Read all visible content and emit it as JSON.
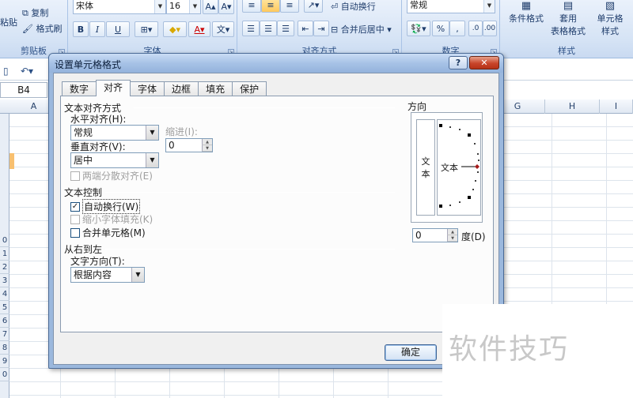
{
  "ribbon": {
    "clipboard": {
      "paste": "粘贴",
      "copy": "复制",
      "format_painter": "格式刷",
      "label": "剪贴板"
    },
    "font": {
      "name": "宋体",
      "size": "16",
      "bold": "B",
      "italic": "I",
      "underline": "U",
      "label": "字体"
    },
    "alignment": {
      "wrap_text": "自动换行",
      "merge_center": "合并后居中",
      "label": "对齐方式"
    },
    "number": {
      "format": "常规",
      "percent": "%",
      "comma": ",",
      "label": "数字"
    },
    "styles": {
      "conditional": "条件格式",
      "table_format_1": "套用",
      "table_format_2": "表格格式",
      "cell_style_1": "单元格",
      "cell_style_2": "样式",
      "label": "样式"
    }
  },
  "sheet": {
    "name_box": "B4",
    "columns": [
      "A",
      "G",
      "H",
      "I"
    ],
    "row_labels": [
      "0",
      "1",
      "2",
      "3",
      "4",
      "5",
      "6",
      "7",
      "8",
      "9",
      "0"
    ]
  },
  "dialog": {
    "title": "设置单元格格式",
    "help": "?",
    "close": "✕",
    "tabs": [
      "数字",
      "对齐",
      "字体",
      "边框",
      "填充",
      "保护"
    ],
    "active_tab": "对齐",
    "text_alignment": {
      "section": "文本对齐方式",
      "horizontal_label": "水平对齐(H):",
      "horizontal_value": "常规",
      "indent_label": "缩进(I):",
      "indent_value": "0",
      "vertical_label": "垂直对齐(V):",
      "vertical_value": "居中",
      "justify_distributed": "两端分散对齐(E)"
    },
    "text_control": {
      "section": "文本控制",
      "wrap_text": "自动换行(W)",
      "wrap_text_checked": true,
      "shrink_to_fit": "缩小字体填充(K)",
      "merge_cells": "合并单元格(M)"
    },
    "rtl": {
      "section": "从右到左",
      "direction_label": "文字方向(T):",
      "direction_value": "根据内容"
    },
    "orientation": {
      "section": "方向",
      "vertical_text_1": "文",
      "vertical_text_2": "本",
      "dial_text": "文本",
      "degrees_value": "0",
      "degrees_label": "度(D)"
    },
    "ok": "确定"
  },
  "watermark": "软件技巧",
  "colors": {
    "accent": "#c0392b",
    "dialog_frame": "#9bb8dd",
    "active_cell": "#f8c070"
  }
}
